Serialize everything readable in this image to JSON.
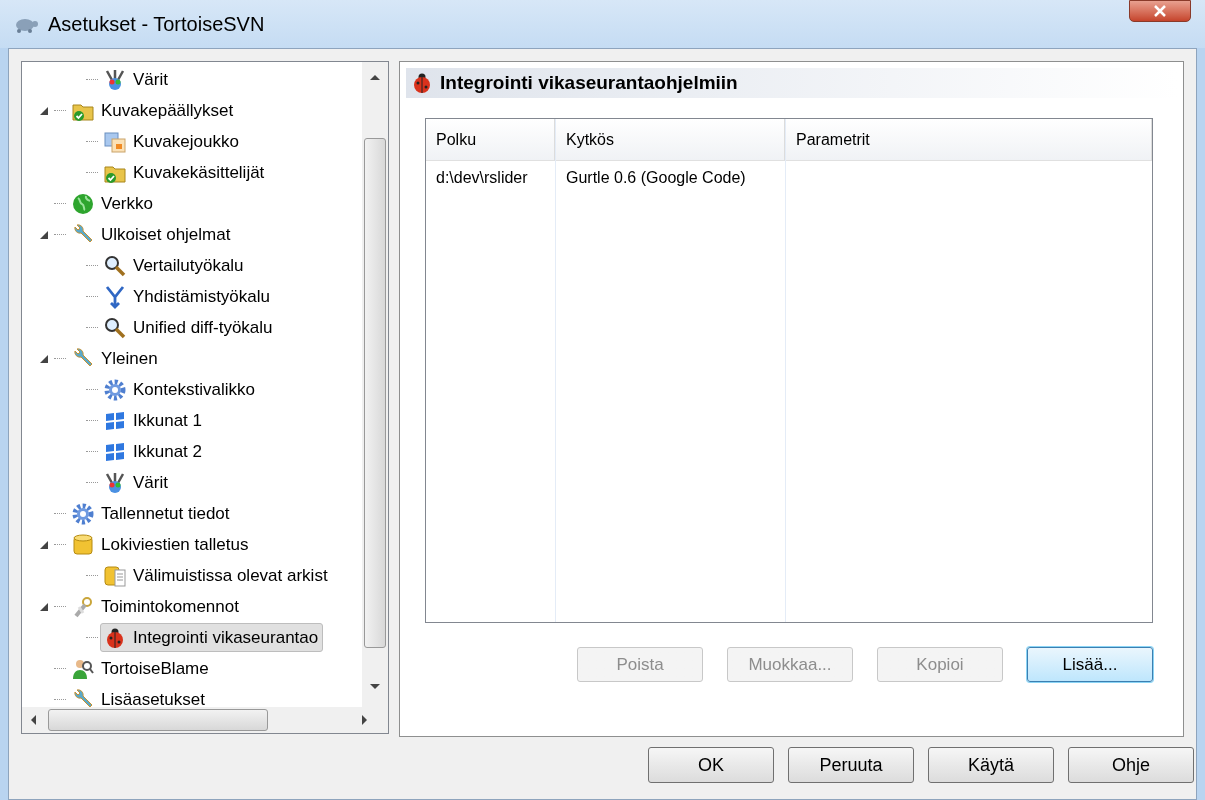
{
  "window": {
    "title": "Asetukset - TortoiseSVN"
  },
  "tree": {
    "items": [
      {
        "children": [
          {
            "label": "Värit",
            "kind": "palette",
            "selected": false
          }
        ]
      },
      {
        "label": "Kuvakepäällykset",
        "kind": "folder-check",
        "expanded": true,
        "selected": false,
        "children": [
          {
            "label": "Kuvakejoukko",
            "kind": "images",
            "selected": false
          },
          {
            "label": "Kuvakekäsittelijät",
            "kind": "folder-check",
            "selected": false
          }
        ]
      },
      {
        "label": "Verkko",
        "kind": "globe",
        "selected": false
      },
      {
        "label": "Ulkoiset ohjelmat",
        "kind": "wrench",
        "expanded": true,
        "selected": false,
        "children": [
          {
            "label": "Vertailutyökalu",
            "kind": "magnifier",
            "selected": false
          },
          {
            "label": "Yhdistämistyökalu",
            "kind": "merge",
            "selected": false
          },
          {
            "label": "Unified diff-työkalu",
            "kind": "magnifier",
            "selected": false
          }
        ]
      },
      {
        "label": "Yleinen",
        "kind": "wrench",
        "expanded": true,
        "selected": false,
        "children": [
          {
            "label": "Kontekstivalikko",
            "kind": "gear",
            "selected": false
          },
          {
            "label": "Ikkunat 1",
            "kind": "flag",
            "selected": false
          },
          {
            "label": "Ikkunat 2",
            "kind": "flag",
            "selected": false
          },
          {
            "label": "Värit",
            "kind": "palette",
            "selected": false
          }
        ]
      },
      {
        "label": "Tallennetut tiedot",
        "kind": "gear",
        "selected": false
      },
      {
        "label": "Lokiviestien talletus",
        "kind": "database",
        "expanded": true,
        "selected": false,
        "children": [
          {
            "label": "Välimuistissa olevat arkist",
            "kind": "database-doc",
            "selected": false
          }
        ]
      },
      {
        "label": "Toimintokomennot",
        "kind": "keys",
        "expanded": true,
        "selected": false,
        "children": [
          {
            "label": "Integrointi vikaseurantao",
            "kind": "bug",
            "selected": true
          }
        ]
      },
      {
        "label": "TortoiseBlame",
        "kind": "person",
        "selected": false
      },
      {
        "label": "Lisäasetukset",
        "kind": "wrench",
        "selected": false
      }
    ]
  },
  "panel": {
    "title": "Integrointi vikaseurantaohjelmiin",
    "table": {
      "columns": [
        "Polku",
        "Kytkös",
        "Parametrit"
      ],
      "rows": [
        [
          "d:\\dev\\rslider",
          "Gurtle 0.6 (Google Code)",
          ""
        ]
      ]
    },
    "buttons": [
      {
        "label": "Poista",
        "disabled": true,
        "default": false
      },
      {
        "label": "Muokkaa...",
        "disabled": true,
        "default": false
      },
      {
        "label": "Kopioi",
        "disabled": true,
        "default": false
      },
      {
        "label": "Lisää...",
        "disabled": false,
        "default": true
      }
    ]
  },
  "dialog_buttons": [
    "OK",
    "Peruuta",
    "Käytä",
    "Ohje"
  ]
}
